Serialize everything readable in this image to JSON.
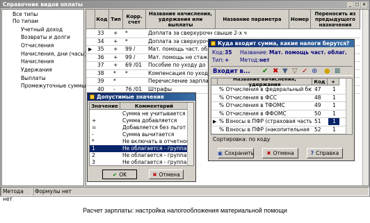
{
  "main": {
    "title": "Справочник видов оплаты",
    "tree": [
      "Все типы",
      "По типам",
      "Учетный доход",
      "Возвраты и долги",
      "Отчисления",
      "Начисления, дни (часы)",
      "Начисления",
      "Удержания",
      "Выплаты",
      "Промежуточные суммы"
    ],
    "columns": [
      "Код",
      "Тип",
      "Корр. счет",
      "Название начисления, удержания или выплаты",
      "Название параметра",
      "Номер",
      "Переносить из предыдущего назначения"
    ],
    "rows": [
      {
        "code": "33",
        "type": "+",
        "acct": "*",
        "name": "Доплата за сверхурочн свыше 2-х ч"
      },
      {
        "code": "34",
        "type": "+",
        "acct": "*",
        "name": "Доплата за сверхурочн свыше 2-х ч"
      },
      {
        "code": "35",
        "type": "+",
        "acct": "99 /",
        "name": "Мат. помощь част. облаг."
      },
      {
        "code": "36",
        "type": "+",
        "acct": "99 /",
        "name": "Мат. помощь не стаж. выдел"
      },
      {
        "code": "37",
        "type": "+",
        "acct": "69 /01",
        "name": "Пособие по уходу до 1.5 лет"
      },
      {
        "code": "38",
        "type": "*",
        "acct": "*",
        "name": "Компенсация по уходу до 3 лет"
      },
      {
        "code": "39",
        "type": "*",
        "acct": "",
        "name": "Перечисление зарплаты в Банк"
      },
      {
        "code": "40",
        "type": "-",
        "acct": "76 /01",
        "name": "Штрафы"
      }
    ],
    "status": [
      "Метода нет",
      "Формулы нет"
    ]
  },
  "dialog": {
    "title": "Куда входит сумма, какие налоги берутся?",
    "code_label": "Код:",
    "code_value": "35",
    "name_label": "Название:",
    "name_value": "Мат. помощь част. облаг.",
    "type_label": "Тип:",
    "type_value": "+",
    "method_label": "Метод:",
    "method_value": "нет",
    "enters_label": "Входит в...",
    "columns": [
      "Название начисления, удержания",
      "Код",
      "+"
    ],
    "rows": [
      {
        "name": "% Отчисления в федеральный бюджет",
        "code": "47",
        "flag": "1"
      },
      {
        "name": "% Отчисления в ФСС",
        "code": "48",
        "flag": "1"
      },
      {
        "name": "% Отчисления в ТФОМС",
        "code": "49",
        "flag": "1"
      },
      {
        "name": "% Отчисления в ФФОМС",
        "code": "50",
        "flag": "1"
      },
      {
        "name": "% Взносы в ПФР (страховая часть)",
        "code": "51",
        "flag": "1"
      },
      {
        "name": "% Взносы в ПФР (накопительная часть)",
        "code": "52",
        "flag": "1"
      }
    ],
    "sort_label": "Сортировка: по коду",
    "save": "Сохранить",
    "cancel": "Отмена",
    "help": "Справка"
  },
  "allowed": {
    "title": "Допустимые значения",
    "columns": [
      "Значение",
      "Комментарий"
    ],
    "rows": [
      {
        "v": "",
        "c": "Сумма не учитывается"
      },
      {
        "v": "+",
        "c": "Сумма добавляется"
      },
      {
        "v": "=",
        "c": "Добавляется без льгот"
      },
      {
        "v": "-",
        "c": "Сумма вычитается"
      },
      {
        "v": "*",
        "c": "Не включать в отчетность"
      },
      {
        "v": "1",
        "c": "Не облагается - группа 1"
      },
      {
        "v": "2",
        "c": "Не облагается - группа 2"
      },
      {
        "v": "3",
        "c": "Не облагается - группа 3"
      }
    ],
    "selected": 5,
    "ok": "OK",
    "cancel": "Отмена"
  },
  "caption": "Расчет зарплаты: настройка налогообложения материальной помощи"
}
